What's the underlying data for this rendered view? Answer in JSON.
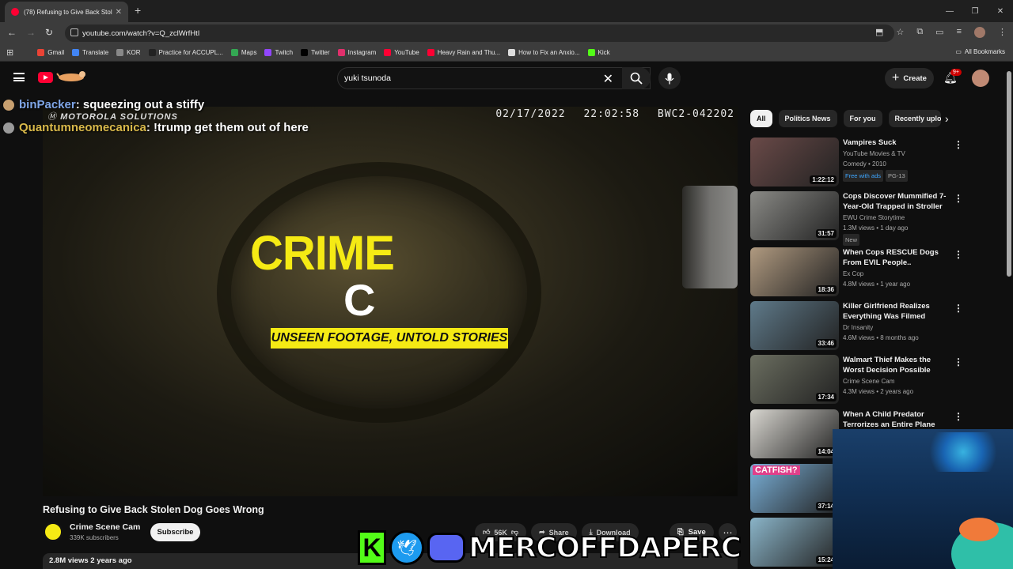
{
  "browser": {
    "tab_title": "(78) Refusing to Give Back Stol",
    "url": "youtube.com/watch?v=Q_zclWrfHtI",
    "bookmarks": [
      {
        "label": "Gmail",
        "color": "#ea4335"
      },
      {
        "label": "Translate",
        "color": "#4285f4"
      },
      {
        "label": "KOR",
        "color": "#888888"
      },
      {
        "label": "Practice for ACCUPL...",
        "color": "#222222"
      },
      {
        "label": "Maps",
        "color": "#34a853"
      },
      {
        "label": "Twitch",
        "color": "#9146ff"
      },
      {
        "label": "Twitter",
        "color": "#000000"
      },
      {
        "label": "Instagram",
        "color": "#e1306c"
      },
      {
        "label": "YouTube",
        "color": "#ff0033"
      },
      {
        "label": "Heavy Rain and Thu...",
        "color": "#ff0033"
      },
      {
        "label": "How to Fix an Anxio...",
        "color": "#dddddd"
      },
      {
        "label": "Kick",
        "color": "#53fc18"
      }
    ],
    "all_bookmarks": "All Bookmarks"
  },
  "youtube": {
    "search_value": "yuki tsunoda",
    "create_label": "Create",
    "notif_count": "9+"
  },
  "player": {
    "brand": "MOTOROLA SOLUTIONS",
    "timestamp": "02/17/2022 22:02:58",
    "device_id": "BWC2-042202",
    "title_line1": "CRIME",
    "title_line2": "C",
    "tagline": "UNSEEN FOOTAGE, UNTOLD STORIES"
  },
  "chat": [
    {
      "user": "binPacker",
      "message": " : squeezing out a stiffy"
    },
    {
      "user": "Quantumneomecanica",
      "message": " : !trump get them out of here"
    }
  ],
  "video": {
    "title": "Refusing to Give Back Stolen Dog Goes Wrong",
    "channel": "Crime Scene Cam",
    "subscribers": "339K subscribers",
    "subscribe_label": "Subscribe",
    "likes": "56K",
    "share_label": "Share",
    "download_label": "Download",
    "save_label": "Save",
    "views_date": "2.8M views  2 years ago"
  },
  "chips": [
    "All",
    "Politics News",
    "For you",
    "Recently uploa"
  ],
  "recommendations": [
    {
      "title": "Vampires Suck",
      "channel": "YouTube Movies & TV",
      "meta": "Comedy • 2010",
      "duration": "1:22:12",
      "tag1": "Free with ads",
      "tag2": "PG-13",
      "color": "#6a4a48"
    },
    {
      "title": "Cops Discover Mummified 7-Year-Old Trapped in Stroller",
      "channel": "EWU Crime Storytime",
      "meta": "1.3M views • 1 day ago",
      "duration": "31:57",
      "tag1": "New",
      "color": "#8a8a86"
    },
    {
      "title": "When Cops RESCUE Dogs From EVIL People..",
      "channel": "Ex Cop",
      "meta": "4.8M views • 1 year ago",
      "duration": "18:36",
      "color": "#b09a80"
    },
    {
      "title": "Killer Girlfriend Realizes Everything Was Filmed",
      "channel": "Dr Insanity",
      "meta": "4.6M views • 8 months ago",
      "duration": "33:46",
      "color": "#5f7a8a"
    },
    {
      "title": "Walmart Thief Makes the Worst Decision Possible",
      "channel": "Crime Scene Cam",
      "meta": "4.3M views • 2 years ago",
      "duration": "17:34",
      "color": "#6b6e60"
    },
    {
      "title": "When A Child Predator Terrorizes an Entire Plane",
      "channel": "",
      "meta": "",
      "duration": "14:04",
      "color": "#d8d6d0"
    },
    {
      "title": "",
      "channel": "",
      "meta": "",
      "duration": "37:14",
      "thumb_text": "CATFISH?",
      "color": "#7ab0d8"
    },
    {
      "title": "",
      "channel": "",
      "meta": "",
      "duration": "15:24",
      "color": "#8ab4c8"
    }
  ],
  "stream_overlay": {
    "kick_letter": "K",
    "handle": "MERCOFFDAPERC"
  }
}
